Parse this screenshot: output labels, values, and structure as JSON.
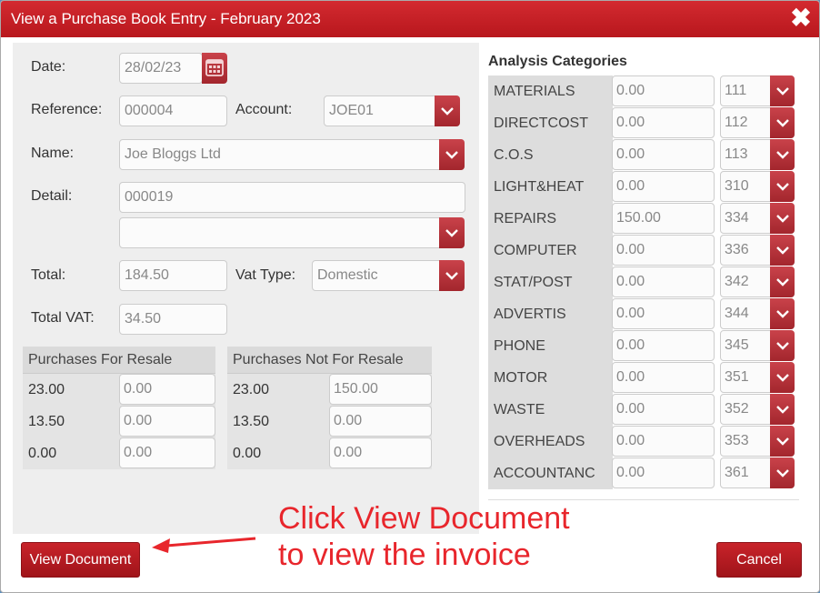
{
  "dialog": {
    "title": "View a Purchase Book Entry - February 2023",
    "close_symbol": "✖"
  },
  "form": {
    "date_label": "Date:",
    "date_value": "28/02/23",
    "reference_label": "Reference:",
    "reference_value": "000004",
    "account_label": "Account:",
    "account_value": "JOE01",
    "name_label": "Name:",
    "name_value": "Joe Bloggs Ltd",
    "detail_label": "Detail:",
    "detail_value": "000019",
    "detail_select_value": "",
    "total_label": "Total:",
    "total_value": "184.50",
    "vat_type_label": "Vat Type:",
    "vat_type_value": "Domestic",
    "total_vat_label": "Total VAT:",
    "total_vat_value": "34.50"
  },
  "vat_tables": {
    "resale": {
      "header": "Purchases For Resale",
      "rows": [
        {
          "rate": "23.00",
          "value": "0.00"
        },
        {
          "rate": "13.50",
          "value": "0.00"
        },
        {
          "rate": "0.00",
          "value": "0.00"
        }
      ]
    },
    "not_resale": {
      "header": "Purchases Not For Resale",
      "rows": [
        {
          "rate": "23.00",
          "value": "150.00"
        },
        {
          "rate": "13.50",
          "value": "0.00"
        },
        {
          "rate": "0.00",
          "value": "0.00"
        }
      ]
    }
  },
  "analysis": {
    "title": "Analysis Categories",
    "rows": [
      {
        "name": "MATERIALS",
        "value": "0.00",
        "code": "111"
      },
      {
        "name": "DIRECTCOST",
        "value": "0.00",
        "code": "112"
      },
      {
        "name": "C.O.S",
        "value": "0.00",
        "code": "113"
      },
      {
        "name": "LIGHT&HEAT",
        "value": "0.00",
        "code": "310"
      },
      {
        "name": "REPAIRS",
        "value": "150.00",
        "code": "334"
      },
      {
        "name": "COMPUTER",
        "value": "0.00",
        "code": "336"
      },
      {
        "name": "STAT/POST",
        "value": "0.00",
        "code": "342"
      },
      {
        "name": "ADVERTIS",
        "value": "0.00",
        "code": "344"
      },
      {
        "name": "PHONE",
        "value": "0.00",
        "code": "345"
      },
      {
        "name": "MOTOR",
        "value": "0.00",
        "code": "351"
      },
      {
        "name": "WASTE",
        "value": "0.00",
        "code": "352"
      },
      {
        "name": "OVERHEADS",
        "value": "0.00",
        "code": "353"
      },
      {
        "name": "ACCOUNTANC",
        "value": "0.00",
        "code": "361"
      }
    ]
  },
  "buttons": {
    "view_document": "View Document",
    "cancel": "Cancel"
  },
  "annotation": {
    "line1": "Click View Document",
    "line2": "to view the invoice"
  },
  "colors": {
    "titlebar": "#c42026",
    "button": "#b01a20",
    "annotation": "#e8262c"
  }
}
